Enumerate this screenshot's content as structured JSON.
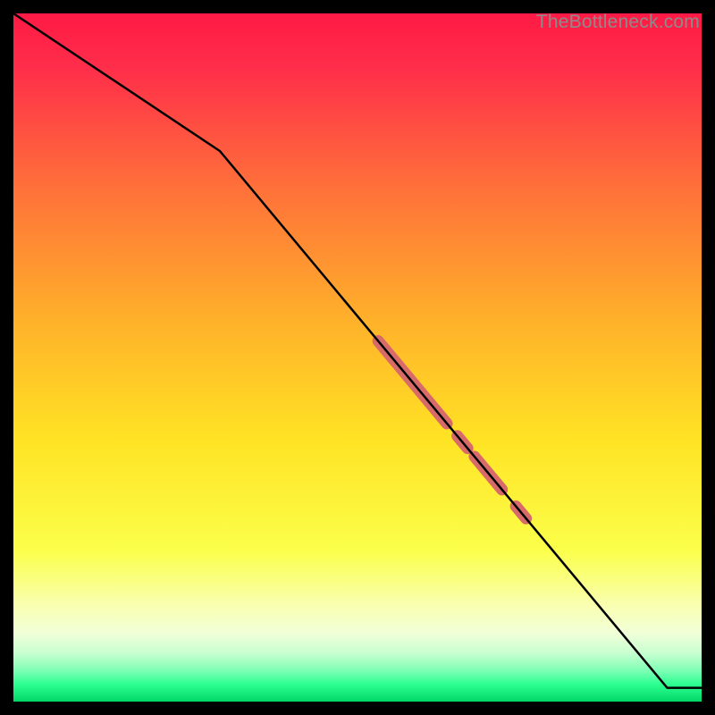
{
  "watermark": "TheBottleneck.com",
  "chart_data": {
    "type": "line",
    "title": "",
    "xlabel": "",
    "ylabel": "",
    "xlim": [
      0,
      100
    ],
    "ylim": [
      0,
      100
    ],
    "grid": false,
    "series": [
      {
        "name": "curve",
        "x": [
          0,
          30,
          95,
          100
        ],
        "y": [
          100,
          80,
          2,
          2
        ]
      }
    ],
    "highlight_segments": [
      {
        "x0": 53,
        "x1": 63
      },
      {
        "x0": 64.5,
        "x1": 66
      },
      {
        "x0": 67,
        "x1": 71
      },
      {
        "x0": 73,
        "x1": 74.5
      }
    ],
    "gradient_colors": {
      "top": "#ff1a45",
      "mid_upper": "#ff8a2b",
      "mid": "#ffe324",
      "mid_lower": "#f5ff7a",
      "bottom_band": "#2dff91",
      "bottom_edge": "#00d867"
    },
    "line_color": "#000000",
    "highlight_color": "#d86a6a"
  }
}
